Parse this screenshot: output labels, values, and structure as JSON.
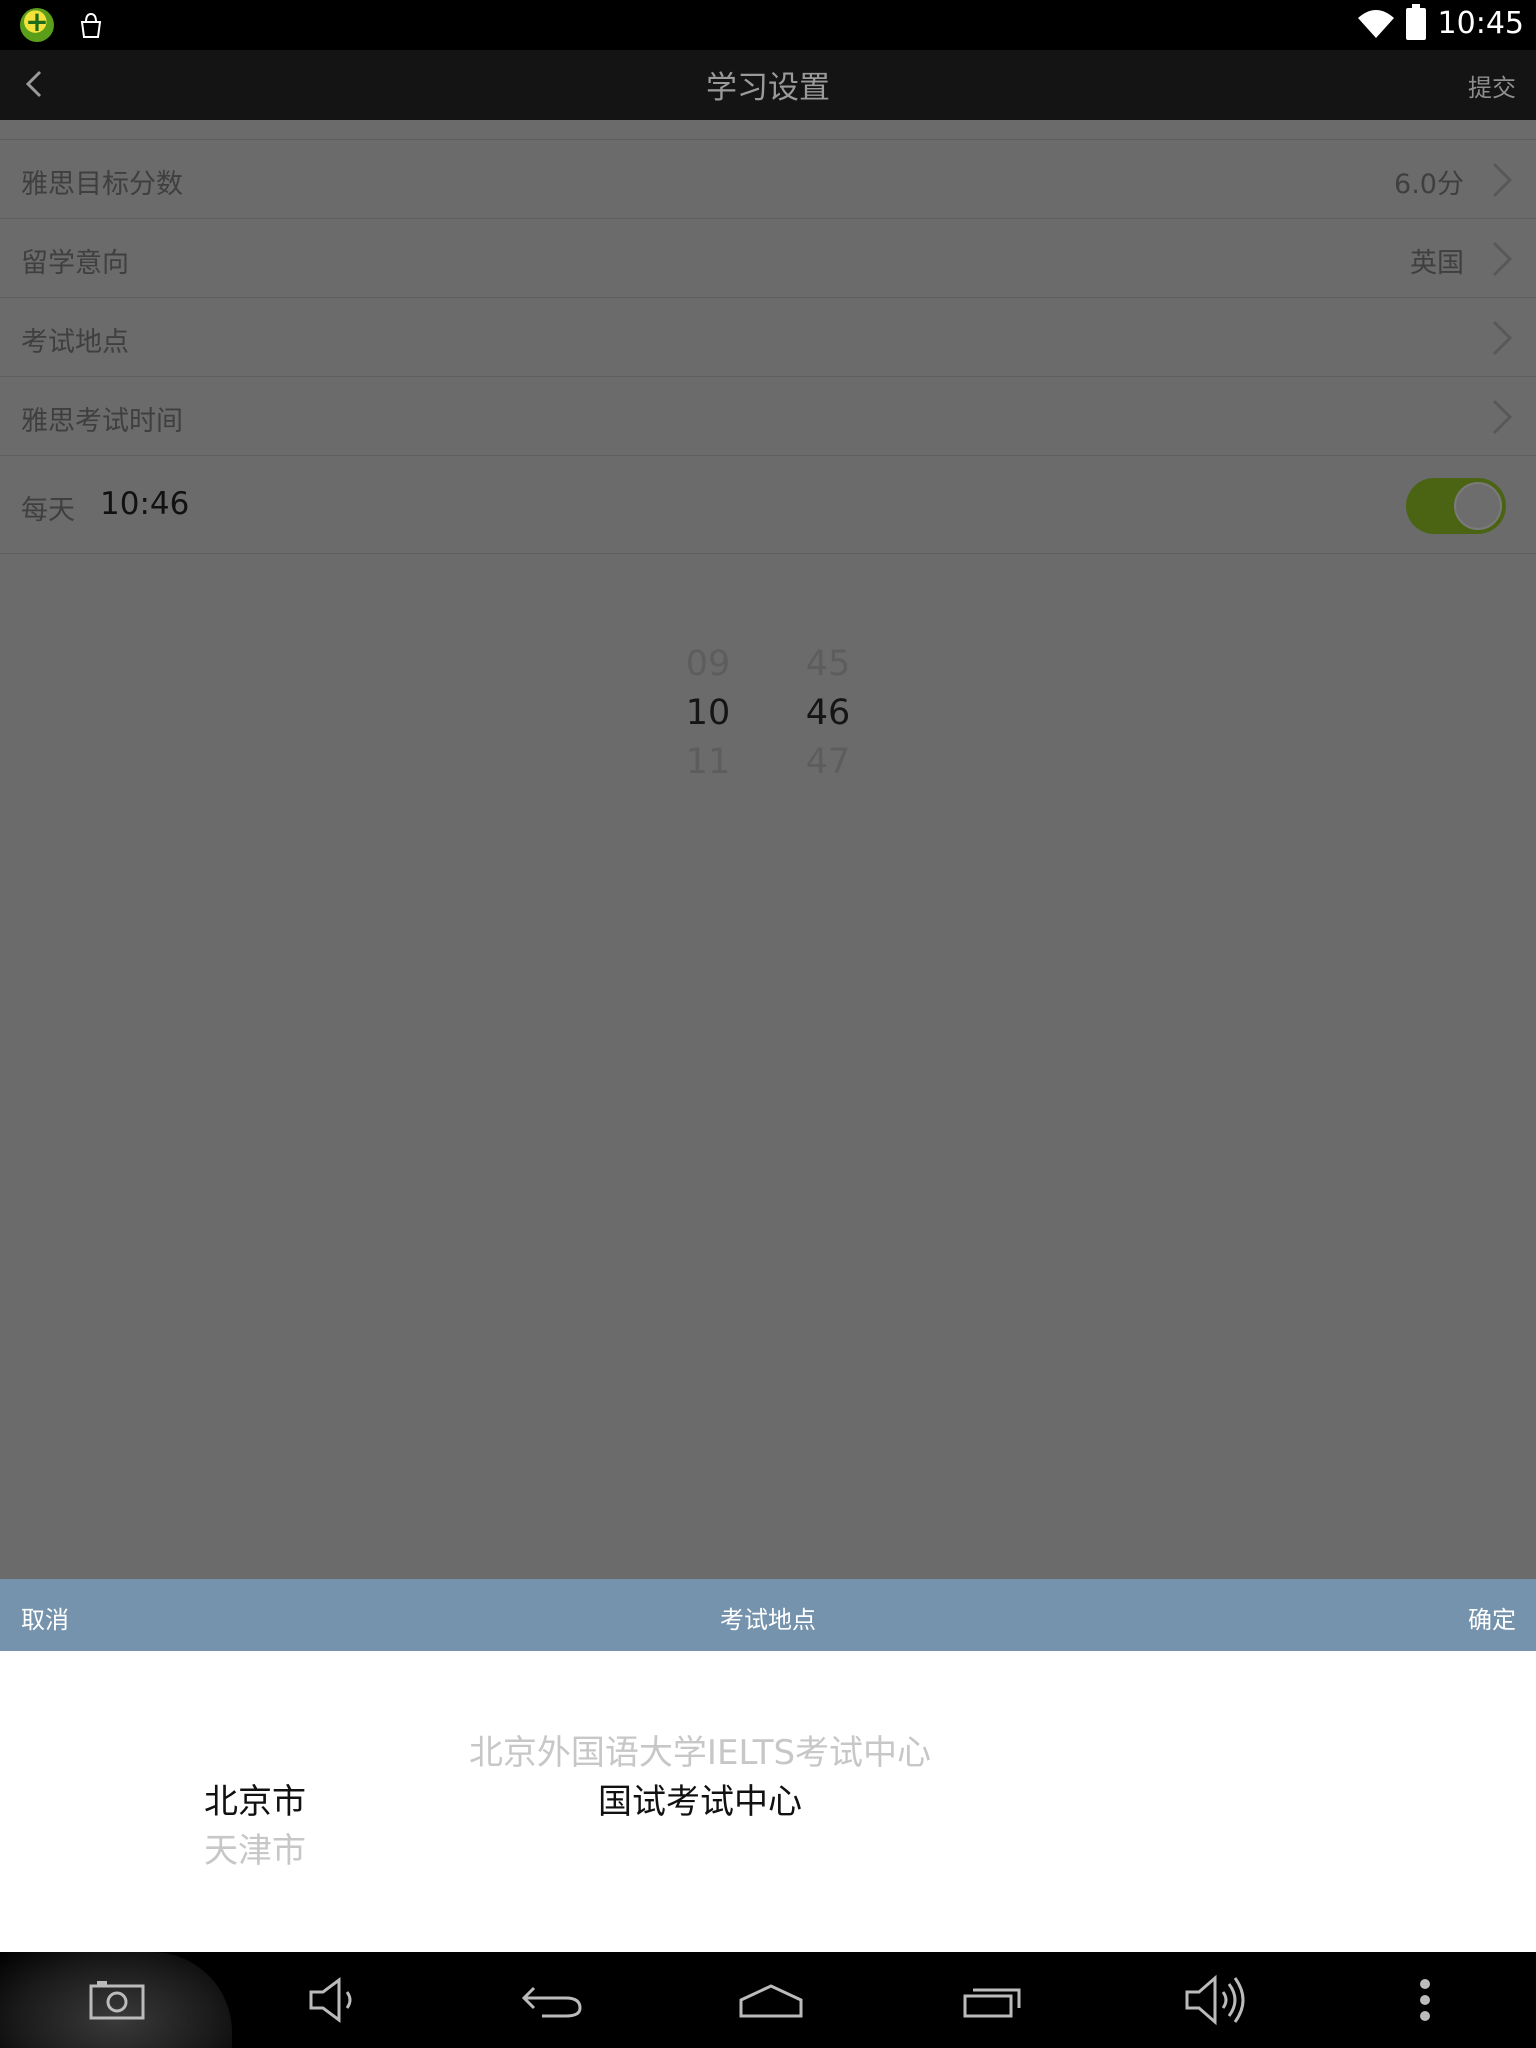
{
  "status_bar": {
    "time": "10:45"
  },
  "header": {
    "title": "学习设置",
    "submit_label": "提交"
  },
  "settings": {
    "rows": [
      {
        "label": "雅思目标分数",
        "value": "6.0分"
      },
      {
        "label": "留学意向",
        "value": "英国"
      },
      {
        "label": "考试地点",
        "value": ""
      },
      {
        "label": "雅思考试时间",
        "value": ""
      }
    ],
    "reminder": {
      "label": "每天",
      "time": "10:46",
      "enabled": true
    }
  },
  "time_picker": {
    "hours": [
      "09",
      "10",
      "11"
    ],
    "minutes": [
      "45",
      "46",
      "47"
    ]
  },
  "location_picker": {
    "cancel_label": "取消",
    "title": "考试地点",
    "confirm_label": "确定",
    "cities": [
      "北京市",
      "天津市"
    ],
    "centers": [
      "北京外国语大学IELTS考试中心",
      "国试考试中心"
    ]
  },
  "colors": {
    "picker_bar": "#7593ac",
    "toggle_on": "#4a6413",
    "overlay": "#6b6b6b"
  }
}
